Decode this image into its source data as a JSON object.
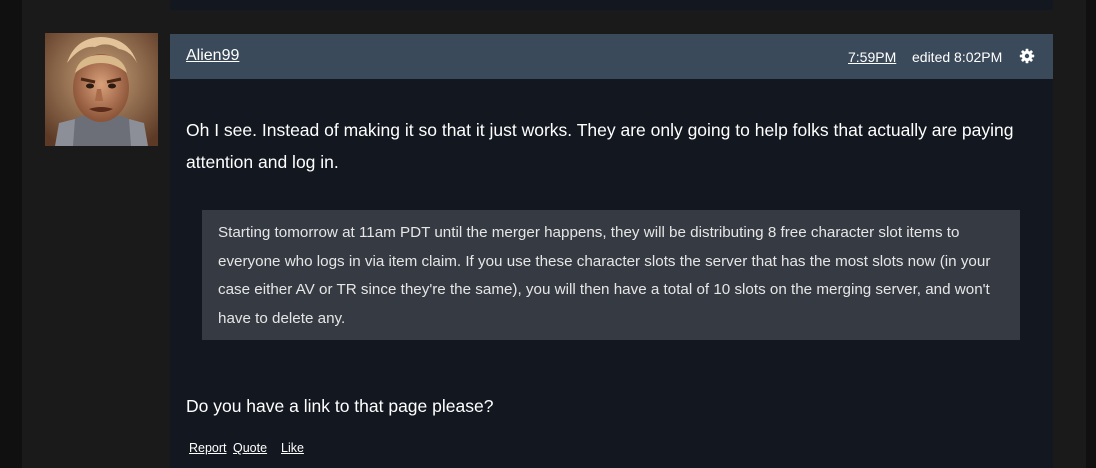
{
  "post": {
    "author": "Alien99",
    "time": "7:59PM",
    "edited": "edited 8:02PM",
    "body_paragraph_1": "Oh I see. Instead of making it so that it just works. They are only going to help folks that actually are paying attention and log in.",
    "quote_text": "Starting tomorrow at 11am PDT until the merger happens, they will be distributing 8 free character slot items to everyone who logs in via item claim. If you use these character slots the server that has the most slots now (in your case either AV or TR since they're the same), you will then have a total of 10 slots on the merging server, and won't have to delete any.",
    "body_paragraph_2": "Do you have a link to that page please?",
    "actions": {
      "report": "Report",
      "quote": "Quote",
      "like": "Like"
    }
  },
  "icons": {
    "settings": "gear-icon"
  },
  "colors": {
    "header_bg": "#3b4a5a",
    "post_bg": "#131720",
    "quote_bg": "#363a43",
    "page_bg": "#1a1a1b"
  }
}
